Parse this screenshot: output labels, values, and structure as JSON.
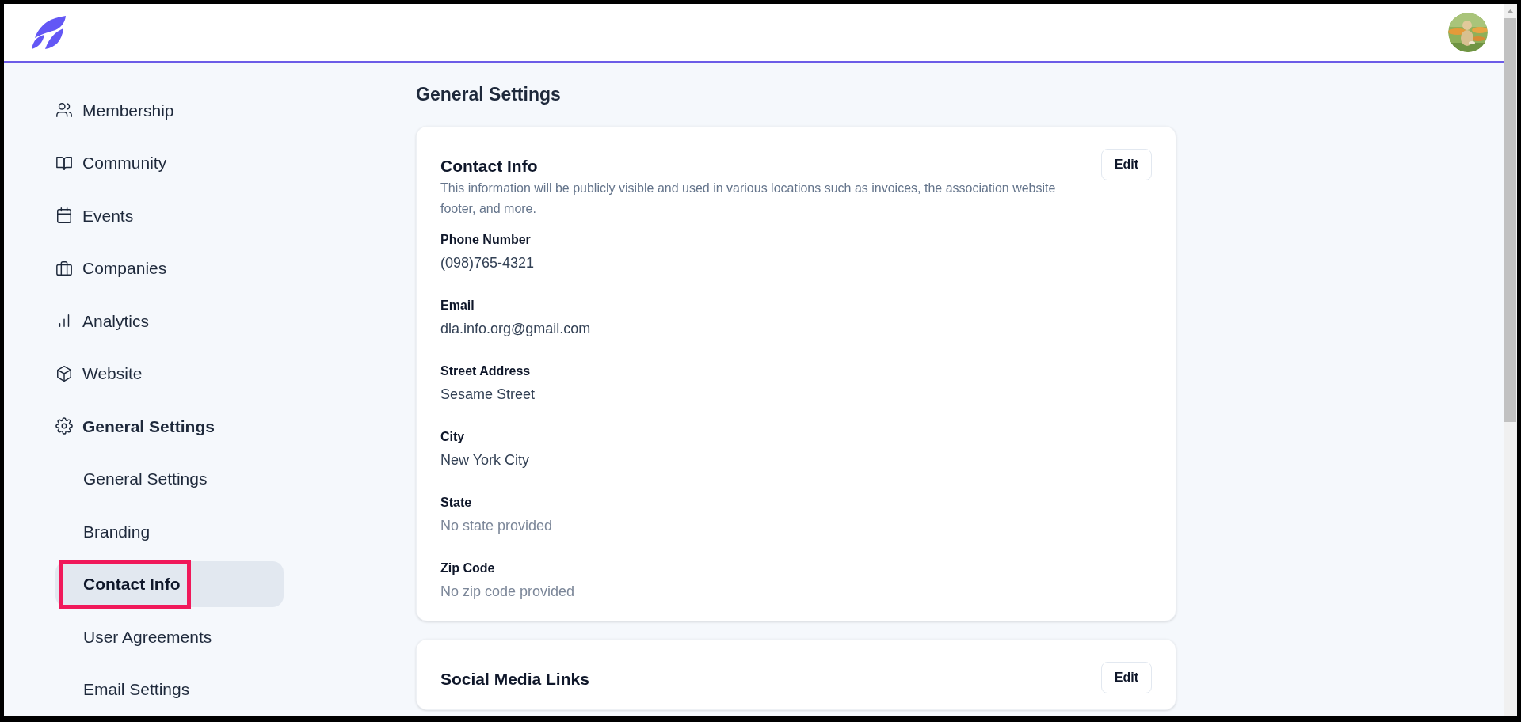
{
  "sidebar": {
    "items": [
      {
        "label": "Membership",
        "selected": false
      },
      {
        "label": "Community",
        "selected": false
      },
      {
        "label": "Events",
        "selected": false
      },
      {
        "label": "Companies",
        "selected": false
      },
      {
        "label": "Analytics",
        "selected": false
      },
      {
        "label": "Website",
        "selected": false
      },
      {
        "label": "General Settings",
        "selected": true,
        "children": [
          {
            "label": "General Settings",
            "selected": false,
            "highlighted": false
          },
          {
            "label": "Branding",
            "selected": false,
            "highlighted": false
          },
          {
            "label": "Contact Info",
            "selected": true,
            "highlighted": true
          },
          {
            "label": "User Agreements",
            "selected": false,
            "highlighted": false
          },
          {
            "label": "Email Settings",
            "selected": false,
            "highlighted": false
          }
        ]
      }
    ]
  },
  "main": {
    "title": "General Settings",
    "cards": [
      {
        "title": "Contact Info",
        "description": "This information will be publicly visible and used in various locations such as invoices, the association website footer, and more.",
        "button": "Edit",
        "fields": [
          {
            "label": "Phone Number",
            "value": "(098)765-4321",
            "provided": true
          },
          {
            "label": "Email",
            "value": "dla.info.org@gmail.com",
            "provided": true
          },
          {
            "label": "Street Address",
            "value": "Sesame Street",
            "provided": true
          },
          {
            "label": "City",
            "value": "New York City",
            "provided": true
          },
          {
            "label": "State",
            "value": "No state provided",
            "provided": false
          },
          {
            "label": "Zip Code",
            "value": "No zip code provided",
            "provided": false
          }
        ]
      },
      {
        "title": "Social Media Links",
        "button": "Edit"
      }
    ]
  }
}
